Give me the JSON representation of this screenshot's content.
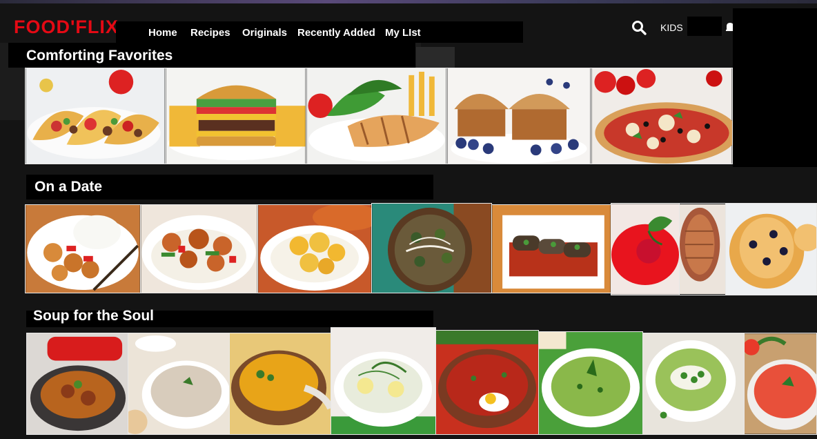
{
  "app": {
    "logo": "FOOD'FLIX"
  },
  "nav": {
    "items": [
      "Home",
      "Recipes",
      "Originals",
      "Recently Added",
      "My LIst"
    ],
    "kids_label": "KIDS"
  },
  "rows": [
    {
      "title": "Comforting Favorites",
      "tiles": [
        "Tacos",
        "Cheeseburger and fries",
        "Grilled chicken salad",
        "Blueberry muffins",
        "Pizza"
      ]
    },
    {
      "title": "On a Date",
      "tiles": [
        "Sweet and sour chicken with rice",
        "Chicken stir fry with rice",
        "Cauliflower curry with rice",
        "Roasted vegetable skillet",
        "Stuffed eggplant rolls",
        "Raspberry dessert",
        "Sliced loaf",
        "Blueberry pastry"
      ]
    },
    {
      "title": "Soup for the Soul",
      "tiles": [
        "Stew in red pot",
        "Mushroom cream soup",
        "Pumpkin soup",
        "Cold egg and herb soup",
        "Borscht with egg",
        "Green cream soup",
        "Green pea soup",
        "Tomato gazpacho"
      ]
    }
  ],
  "colors": {
    "logo": "#e50914",
    "background": "#141414"
  },
  "icons": {
    "search": "search-icon",
    "notifications": "bell-icon"
  }
}
